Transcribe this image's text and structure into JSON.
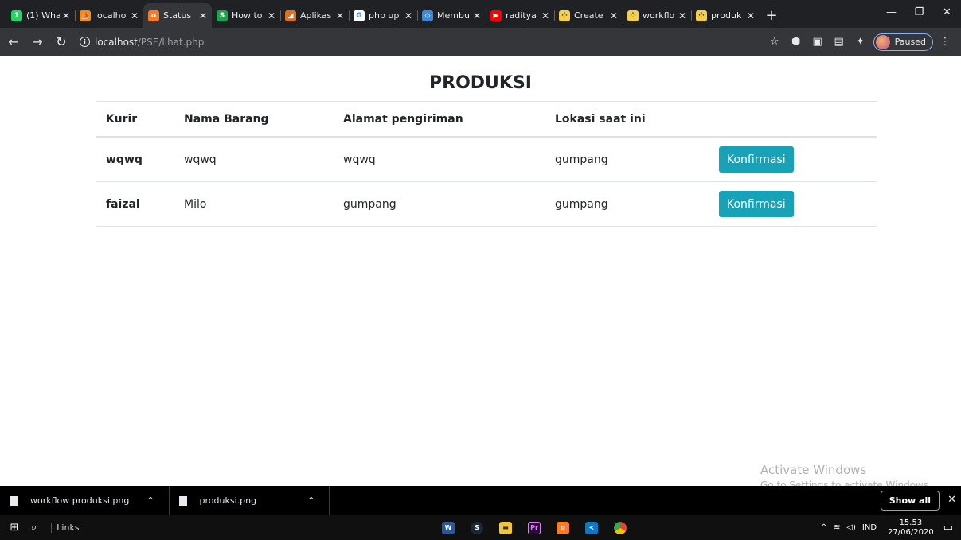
{
  "browser": {
    "tabs": [
      {
        "title": "(1) Wha",
        "favicon": "whatsapp-icon",
        "color": "#25d366",
        "glyph": "1",
        "active": false
      },
      {
        "title": "localho",
        "favicon": "phpmyadmin-icon",
        "color": "#f29111",
        "glyph": "⛵",
        "active": false
      },
      {
        "title": "Status",
        "favicon": "xampp-icon",
        "color": "#fb7a24",
        "glyph": "ʊ",
        "active": true
      },
      {
        "title": "How to",
        "favicon": "sitepoint-icon",
        "color": "#1aa64a",
        "glyph": "S",
        "active": false
      },
      {
        "title": "Aplikas",
        "favicon": "app-icon",
        "color": "#e06f1c",
        "glyph": "◢",
        "active": false
      },
      {
        "title": "php up",
        "favicon": "google-icon",
        "color": "#ffffff",
        "glyph": "G",
        "active": false
      },
      {
        "title": "Membu",
        "favicon": "code-icon",
        "color": "#3b8bd8",
        "glyph": "◇",
        "active": false
      },
      {
        "title": "raditya",
        "favicon": "youtube-icon",
        "color": "#ff0000",
        "glyph": "▶",
        "active": false
      },
      {
        "title": "Create",
        "favicon": "glitch-icon",
        "color": "#f4cf4a",
        "glyph": "⁘",
        "active": false
      },
      {
        "title": "workflo",
        "favicon": "glitch-icon",
        "color": "#f4cf4a",
        "glyph": "⁘",
        "active": false
      },
      {
        "title": "produk",
        "favicon": "glitch-icon",
        "color": "#f4cf4a",
        "glyph": "⁘",
        "active": false
      }
    ],
    "url_host": "localhost",
    "url_path": "/PSE/lihat.php",
    "profile_status": "Paused"
  },
  "page": {
    "title": "PRODUKSI",
    "columns": [
      "Kurir",
      "Nama Barang",
      "Alamat pengiriman",
      "Lokasi saat ini"
    ],
    "rows": [
      {
        "kurir": "wqwq",
        "nama_barang": "wqwq",
        "alamat": "wqwq",
        "lokasi": "gumpang",
        "action": "Konfirmasi"
      },
      {
        "kurir": "faizal",
        "nama_barang": "Milo",
        "alamat": "gumpang",
        "lokasi": "gumpang",
        "action": "Konfirmasi"
      }
    ],
    "button_color": "#17a2b8"
  },
  "watermark": {
    "line1": "Activate Windows",
    "line2": "Go to Settings to activate Windows."
  },
  "downloads": {
    "items": [
      "workflow produksi.png",
      "produksi.png"
    ],
    "show_all": "Show all"
  },
  "taskbar": {
    "links_label": "Links",
    "language": "IND",
    "time": "15.53",
    "date": "27/06/2020"
  }
}
